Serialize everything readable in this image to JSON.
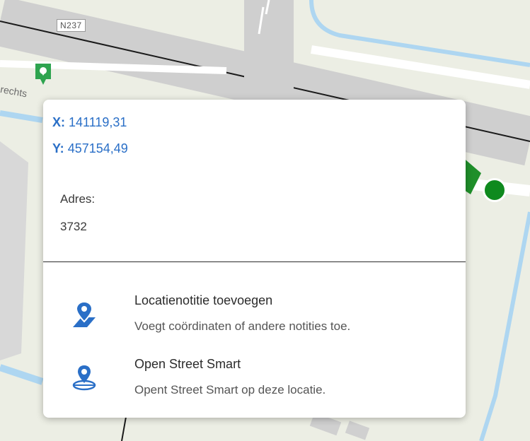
{
  "map": {
    "road_label": "N237",
    "street_label_fragment": "rechts",
    "colors": {
      "background": "#eceee4",
      "road": "#c9c9c9",
      "water": "#aed6f1",
      "accent_green": "#0f8a1e"
    }
  },
  "popup": {
    "coords": {
      "x_label": "X:",
      "x_value": "141119,31",
      "y_label": "Y:",
      "y_value": "457154,49"
    },
    "address": {
      "label": "Adres:",
      "value": "3732"
    },
    "actions": [
      {
        "title": "Locatienotitie toevoegen",
        "description": "Voegt coördinaten of andere notities toe.",
        "icon": "location-note-icon"
      },
      {
        "title": "Open Street Smart",
        "description": "Opent Street Smart op deze locatie.",
        "icon": "street-smart-icon"
      }
    ],
    "colors": {
      "link": "#2a6fc7",
      "text": "#2b2b2b",
      "muted": "#555555"
    }
  }
}
